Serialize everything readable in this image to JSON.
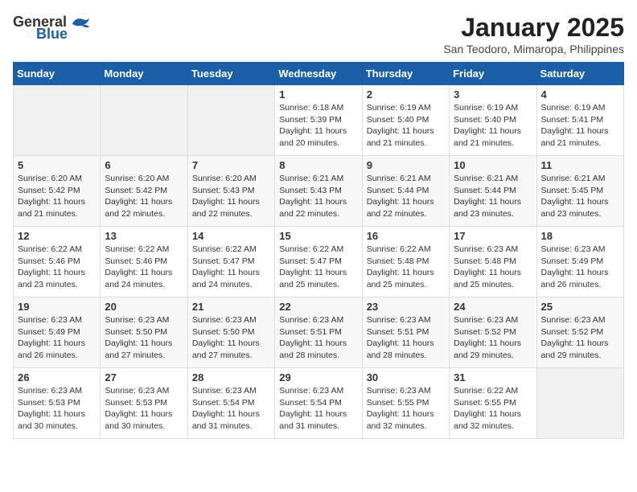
{
  "header": {
    "logo_general": "General",
    "logo_blue": "Blue",
    "title": "January 2025",
    "subtitle": "San Teodoro, Mimaropa, Philippines"
  },
  "days_of_week": [
    "Sunday",
    "Monday",
    "Tuesday",
    "Wednesday",
    "Thursday",
    "Friday",
    "Saturday"
  ],
  "weeks": [
    [
      {
        "day": "",
        "sunrise": "",
        "sunset": "",
        "daylight": "",
        "empty": true
      },
      {
        "day": "",
        "sunrise": "",
        "sunset": "",
        "daylight": "",
        "empty": true
      },
      {
        "day": "",
        "sunrise": "",
        "sunset": "",
        "daylight": "",
        "empty": true
      },
      {
        "day": "1",
        "sunrise": "Sunrise: 6:18 AM",
        "sunset": "Sunset: 5:39 PM",
        "daylight": "Daylight: 11 hours and 20 minutes."
      },
      {
        "day": "2",
        "sunrise": "Sunrise: 6:19 AM",
        "sunset": "Sunset: 5:40 PM",
        "daylight": "Daylight: 11 hours and 21 minutes."
      },
      {
        "day": "3",
        "sunrise": "Sunrise: 6:19 AM",
        "sunset": "Sunset: 5:40 PM",
        "daylight": "Daylight: 11 hours and 21 minutes."
      },
      {
        "day": "4",
        "sunrise": "Sunrise: 6:19 AM",
        "sunset": "Sunset: 5:41 PM",
        "daylight": "Daylight: 11 hours and 21 minutes."
      }
    ],
    [
      {
        "day": "5",
        "sunrise": "Sunrise: 6:20 AM",
        "sunset": "Sunset: 5:42 PM",
        "daylight": "Daylight: 11 hours and 21 minutes."
      },
      {
        "day": "6",
        "sunrise": "Sunrise: 6:20 AM",
        "sunset": "Sunset: 5:42 PM",
        "daylight": "Daylight: 11 hours and 22 minutes."
      },
      {
        "day": "7",
        "sunrise": "Sunrise: 6:20 AM",
        "sunset": "Sunset: 5:43 PM",
        "daylight": "Daylight: 11 hours and 22 minutes."
      },
      {
        "day": "8",
        "sunrise": "Sunrise: 6:21 AM",
        "sunset": "Sunset: 5:43 PM",
        "daylight": "Daylight: 11 hours and 22 minutes."
      },
      {
        "day": "9",
        "sunrise": "Sunrise: 6:21 AM",
        "sunset": "Sunset: 5:44 PM",
        "daylight": "Daylight: 11 hours and 22 minutes."
      },
      {
        "day": "10",
        "sunrise": "Sunrise: 6:21 AM",
        "sunset": "Sunset: 5:44 PM",
        "daylight": "Daylight: 11 hours and 23 minutes."
      },
      {
        "day": "11",
        "sunrise": "Sunrise: 6:21 AM",
        "sunset": "Sunset: 5:45 PM",
        "daylight": "Daylight: 11 hours and 23 minutes."
      }
    ],
    [
      {
        "day": "12",
        "sunrise": "Sunrise: 6:22 AM",
        "sunset": "Sunset: 5:46 PM",
        "daylight": "Daylight: 11 hours and 23 minutes."
      },
      {
        "day": "13",
        "sunrise": "Sunrise: 6:22 AM",
        "sunset": "Sunset: 5:46 PM",
        "daylight": "Daylight: 11 hours and 24 minutes."
      },
      {
        "day": "14",
        "sunrise": "Sunrise: 6:22 AM",
        "sunset": "Sunset: 5:47 PM",
        "daylight": "Daylight: 11 hours and 24 minutes."
      },
      {
        "day": "15",
        "sunrise": "Sunrise: 6:22 AM",
        "sunset": "Sunset: 5:47 PM",
        "daylight": "Daylight: 11 hours and 25 minutes."
      },
      {
        "day": "16",
        "sunrise": "Sunrise: 6:22 AM",
        "sunset": "Sunset: 5:48 PM",
        "daylight": "Daylight: 11 hours and 25 minutes."
      },
      {
        "day": "17",
        "sunrise": "Sunrise: 6:23 AM",
        "sunset": "Sunset: 5:48 PM",
        "daylight": "Daylight: 11 hours and 25 minutes."
      },
      {
        "day": "18",
        "sunrise": "Sunrise: 6:23 AM",
        "sunset": "Sunset: 5:49 PM",
        "daylight": "Daylight: 11 hours and 26 minutes."
      }
    ],
    [
      {
        "day": "19",
        "sunrise": "Sunrise: 6:23 AM",
        "sunset": "Sunset: 5:49 PM",
        "daylight": "Daylight: 11 hours and 26 minutes."
      },
      {
        "day": "20",
        "sunrise": "Sunrise: 6:23 AM",
        "sunset": "Sunset: 5:50 PM",
        "daylight": "Daylight: 11 hours and 27 minutes."
      },
      {
        "day": "21",
        "sunrise": "Sunrise: 6:23 AM",
        "sunset": "Sunset: 5:50 PM",
        "daylight": "Daylight: 11 hours and 27 minutes."
      },
      {
        "day": "22",
        "sunrise": "Sunrise: 6:23 AM",
        "sunset": "Sunset: 5:51 PM",
        "daylight": "Daylight: 11 hours and 28 minutes."
      },
      {
        "day": "23",
        "sunrise": "Sunrise: 6:23 AM",
        "sunset": "Sunset: 5:51 PM",
        "daylight": "Daylight: 11 hours and 28 minutes."
      },
      {
        "day": "24",
        "sunrise": "Sunrise: 6:23 AM",
        "sunset": "Sunset: 5:52 PM",
        "daylight": "Daylight: 11 hours and 29 minutes."
      },
      {
        "day": "25",
        "sunrise": "Sunrise: 6:23 AM",
        "sunset": "Sunset: 5:52 PM",
        "daylight": "Daylight: 11 hours and 29 minutes."
      }
    ],
    [
      {
        "day": "26",
        "sunrise": "Sunrise: 6:23 AM",
        "sunset": "Sunset: 5:53 PM",
        "daylight": "Daylight: 11 hours and 30 minutes."
      },
      {
        "day": "27",
        "sunrise": "Sunrise: 6:23 AM",
        "sunset": "Sunset: 5:53 PM",
        "daylight": "Daylight: 11 hours and 30 minutes."
      },
      {
        "day": "28",
        "sunrise": "Sunrise: 6:23 AM",
        "sunset": "Sunset: 5:54 PM",
        "daylight": "Daylight: 11 hours and 31 minutes."
      },
      {
        "day": "29",
        "sunrise": "Sunrise: 6:23 AM",
        "sunset": "Sunset: 5:54 PM",
        "daylight": "Daylight: 11 hours and 31 minutes."
      },
      {
        "day": "30",
        "sunrise": "Sunrise: 6:23 AM",
        "sunset": "Sunset: 5:55 PM",
        "daylight": "Daylight: 11 hours and 32 minutes."
      },
      {
        "day": "31",
        "sunrise": "Sunrise: 6:22 AM",
        "sunset": "Sunset: 5:55 PM",
        "daylight": "Daylight: 11 hours and 32 minutes."
      },
      {
        "day": "",
        "sunrise": "",
        "sunset": "",
        "daylight": "",
        "empty": true
      }
    ]
  ]
}
